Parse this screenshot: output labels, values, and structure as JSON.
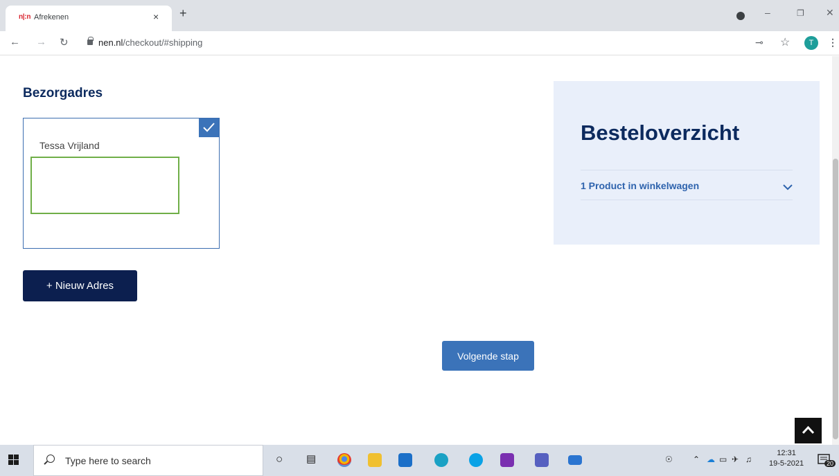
{
  "browser": {
    "tab": {
      "favicon_text": "n|:n",
      "title": "Afrekenen",
      "close_glyph": "×"
    },
    "new_tab_glyph": "+",
    "url_host": "nen.nl",
    "url_path": "/checkout/#shipping",
    "avatar_letter": "T"
  },
  "page": {
    "delivery_title": "Bezorgadres",
    "address": {
      "name": "Tessa Vrijland",
      "selected": true
    },
    "new_address_button": "+ Nieuw Adres",
    "next_button": "Volgende stap",
    "summary": {
      "title": "Besteloverzicht",
      "cart_row": "1 Product in winkelwagen"
    }
  },
  "taskbar": {
    "search_placeholder": "Type here to search",
    "time": "12:31",
    "date": "19-5-2021",
    "notification_count": "20"
  },
  "colors": {
    "navy": "#0c2a5e",
    "accent_blue": "#3b73b9",
    "summary_bg": "#e9effa",
    "selection_green": "#6fae47"
  }
}
